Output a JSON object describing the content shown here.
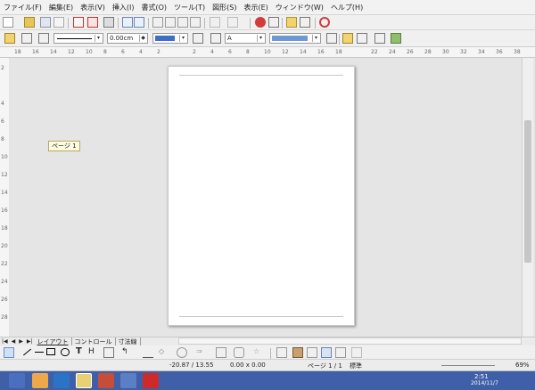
{
  "menu": [
    "ファイル(F)",
    "編集(E)",
    "表示(V)",
    "挿入(I)",
    "書式(O)",
    "ツール(T)",
    "図形(S)",
    "表示(E)",
    "ウィンドウ(W)",
    "ヘルプ(H)"
  ],
  "toolbar2": {
    "line_width": "0.00cm",
    "zoom_icon_label": "A"
  },
  "hruler_ticks": [
    "18",
    "16",
    "14",
    "12",
    "10",
    "8",
    "6",
    "4",
    "2",
    "",
    "2",
    "4",
    "6",
    "8",
    "10",
    "12",
    "14",
    "16",
    "18",
    "",
    "22",
    "24",
    "26",
    "28",
    "30",
    "32",
    "34",
    "36",
    "38"
  ],
  "vruler_ticks": [
    "2",
    "",
    "4",
    "6",
    "8",
    "10",
    "12",
    "14",
    "16",
    "18",
    "20",
    "22",
    "24",
    "26",
    "28"
  ],
  "tooltip": "ページ 1",
  "tabs": [
    "レイアウト",
    "コントロール",
    "寸法線"
  ],
  "statusbar": {
    "position": "-20.87 / 13.55",
    "size": "0.00 x 0.00",
    "page": "ページ 1 / 1",
    "mode": "標準",
    "zoom": "69%"
  },
  "taskbar": {
    "time": "2:51",
    "date": "2014/11/7"
  },
  "colors": {
    "taskbar": "#3f5fa8",
    "line_color_swatch": "#3d6fc6",
    "area_color_swatch": "#6e99d4"
  }
}
